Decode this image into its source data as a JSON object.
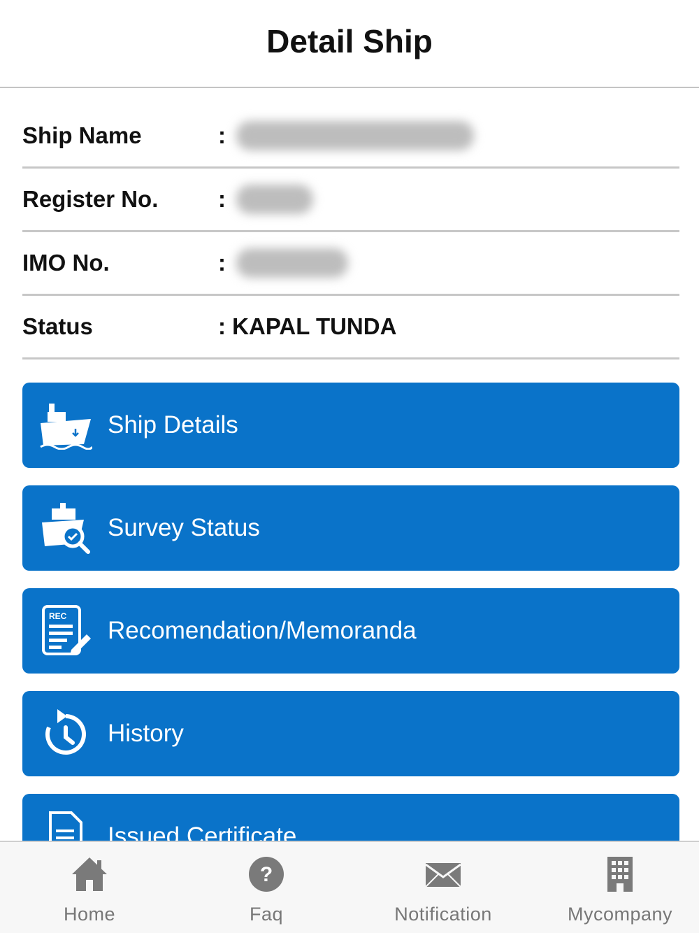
{
  "header": {
    "title": "Detail Ship"
  },
  "info": {
    "ship_name_label": "Ship Name",
    "register_label": "Register No.",
    "imo_label": "IMO No.",
    "status_label": "Status",
    "colon": ":",
    "status_value": ": KAPAL TUNDA"
  },
  "menu": [
    {
      "label": "Ship Details",
      "icon": "ship-icon"
    },
    {
      "label": "Survey Status",
      "icon": "survey-icon"
    },
    {
      "label": "Recomendation/Memoranda",
      "icon": "document-edit-icon"
    },
    {
      "label": "History",
      "icon": "history-icon"
    },
    {
      "label": "Issued Certificate",
      "icon": "certificate-icon"
    }
  ],
  "tabs": [
    {
      "label": "Home",
      "icon": "home-icon"
    },
    {
      "label": "Faq",
      "icon": "question-icon"
    },
    {
      "label": "Notification",
      "icon": "envelope-icon"
    },
    {
      "label": "Mycompany",
      "icon": "building-icon"
    }
  ],
  "colors": {
    "primary": "#0a73c9",
    "tab_icon": "#7a7a7a"
  }
}
